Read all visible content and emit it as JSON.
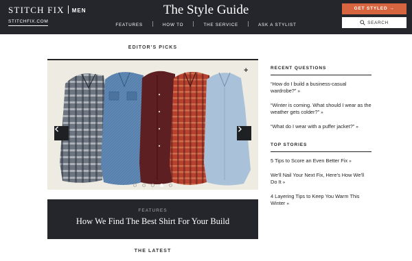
{
  "header": {
    "brand": "STITCH FIX",
    "brand_sub": "MEN",
    "domain_link": "STITCHFIX.COM",
    "site_title": "The Style Guide",
    "nav": [
      "FEATURES",
      "HOW TO",
      "THE SERVICE",
      "ASK A STYLIST"
    ],
    "cta_label": "GET STYLED",
    "cta_arrow": "→",
    "search_label": "SEARCH"
  },
  "editors_picks": {
    "label": "EDITOR'S PICKS",
    "slide_count": 5,
    "active_slide": 4,
    "caption_kicker": "FEATURES",
    "caption_headline": "How We Find The Best Shirt For Your Build",
    "plus_icon": "+",
    "icons": [
      "chevron-left-icon",
      "chevron-right-icon",
      "plus-icon"
    ]
  },
  "recent_questions": {
    "heading": "RECENT QUESTIONS",
    "items": [
      "“How do I build a business-casual wardrobe?”",
      "“Winter is coming. What should I wear as the weather gets colder?”",
      "“What do I wear with a puffer jacket?”"
    ],
    "chevron": "»"
  },
  "top_stories": {
    "heading": "TOP STORIES",
    "items": [
      "5 Tips to Score an Even Better Fix",
      "We'll Nail Your Next Fix, Here's How We'll Do It",
      "4 Layering Tips to Keep You Warm This Winter"
    ],
    "chevron": "»"
  },
  "latest": {
    "label": "THE LATEST"
  },
  "colors": {
    "header_bg": "#24262b",
    "accent": "#d7653f",
    "photo_bg": "#eeebe2",
    "shirt_plaid_gray": "#6d7580",
    "shirt_denim": "#5f88b4",
    "shirt_burgundy": "#5e1f22",
    "shirt_red_plaid": "#b7412e",
    "shirt_light_blue": "#a9c1d9"
  }
}
